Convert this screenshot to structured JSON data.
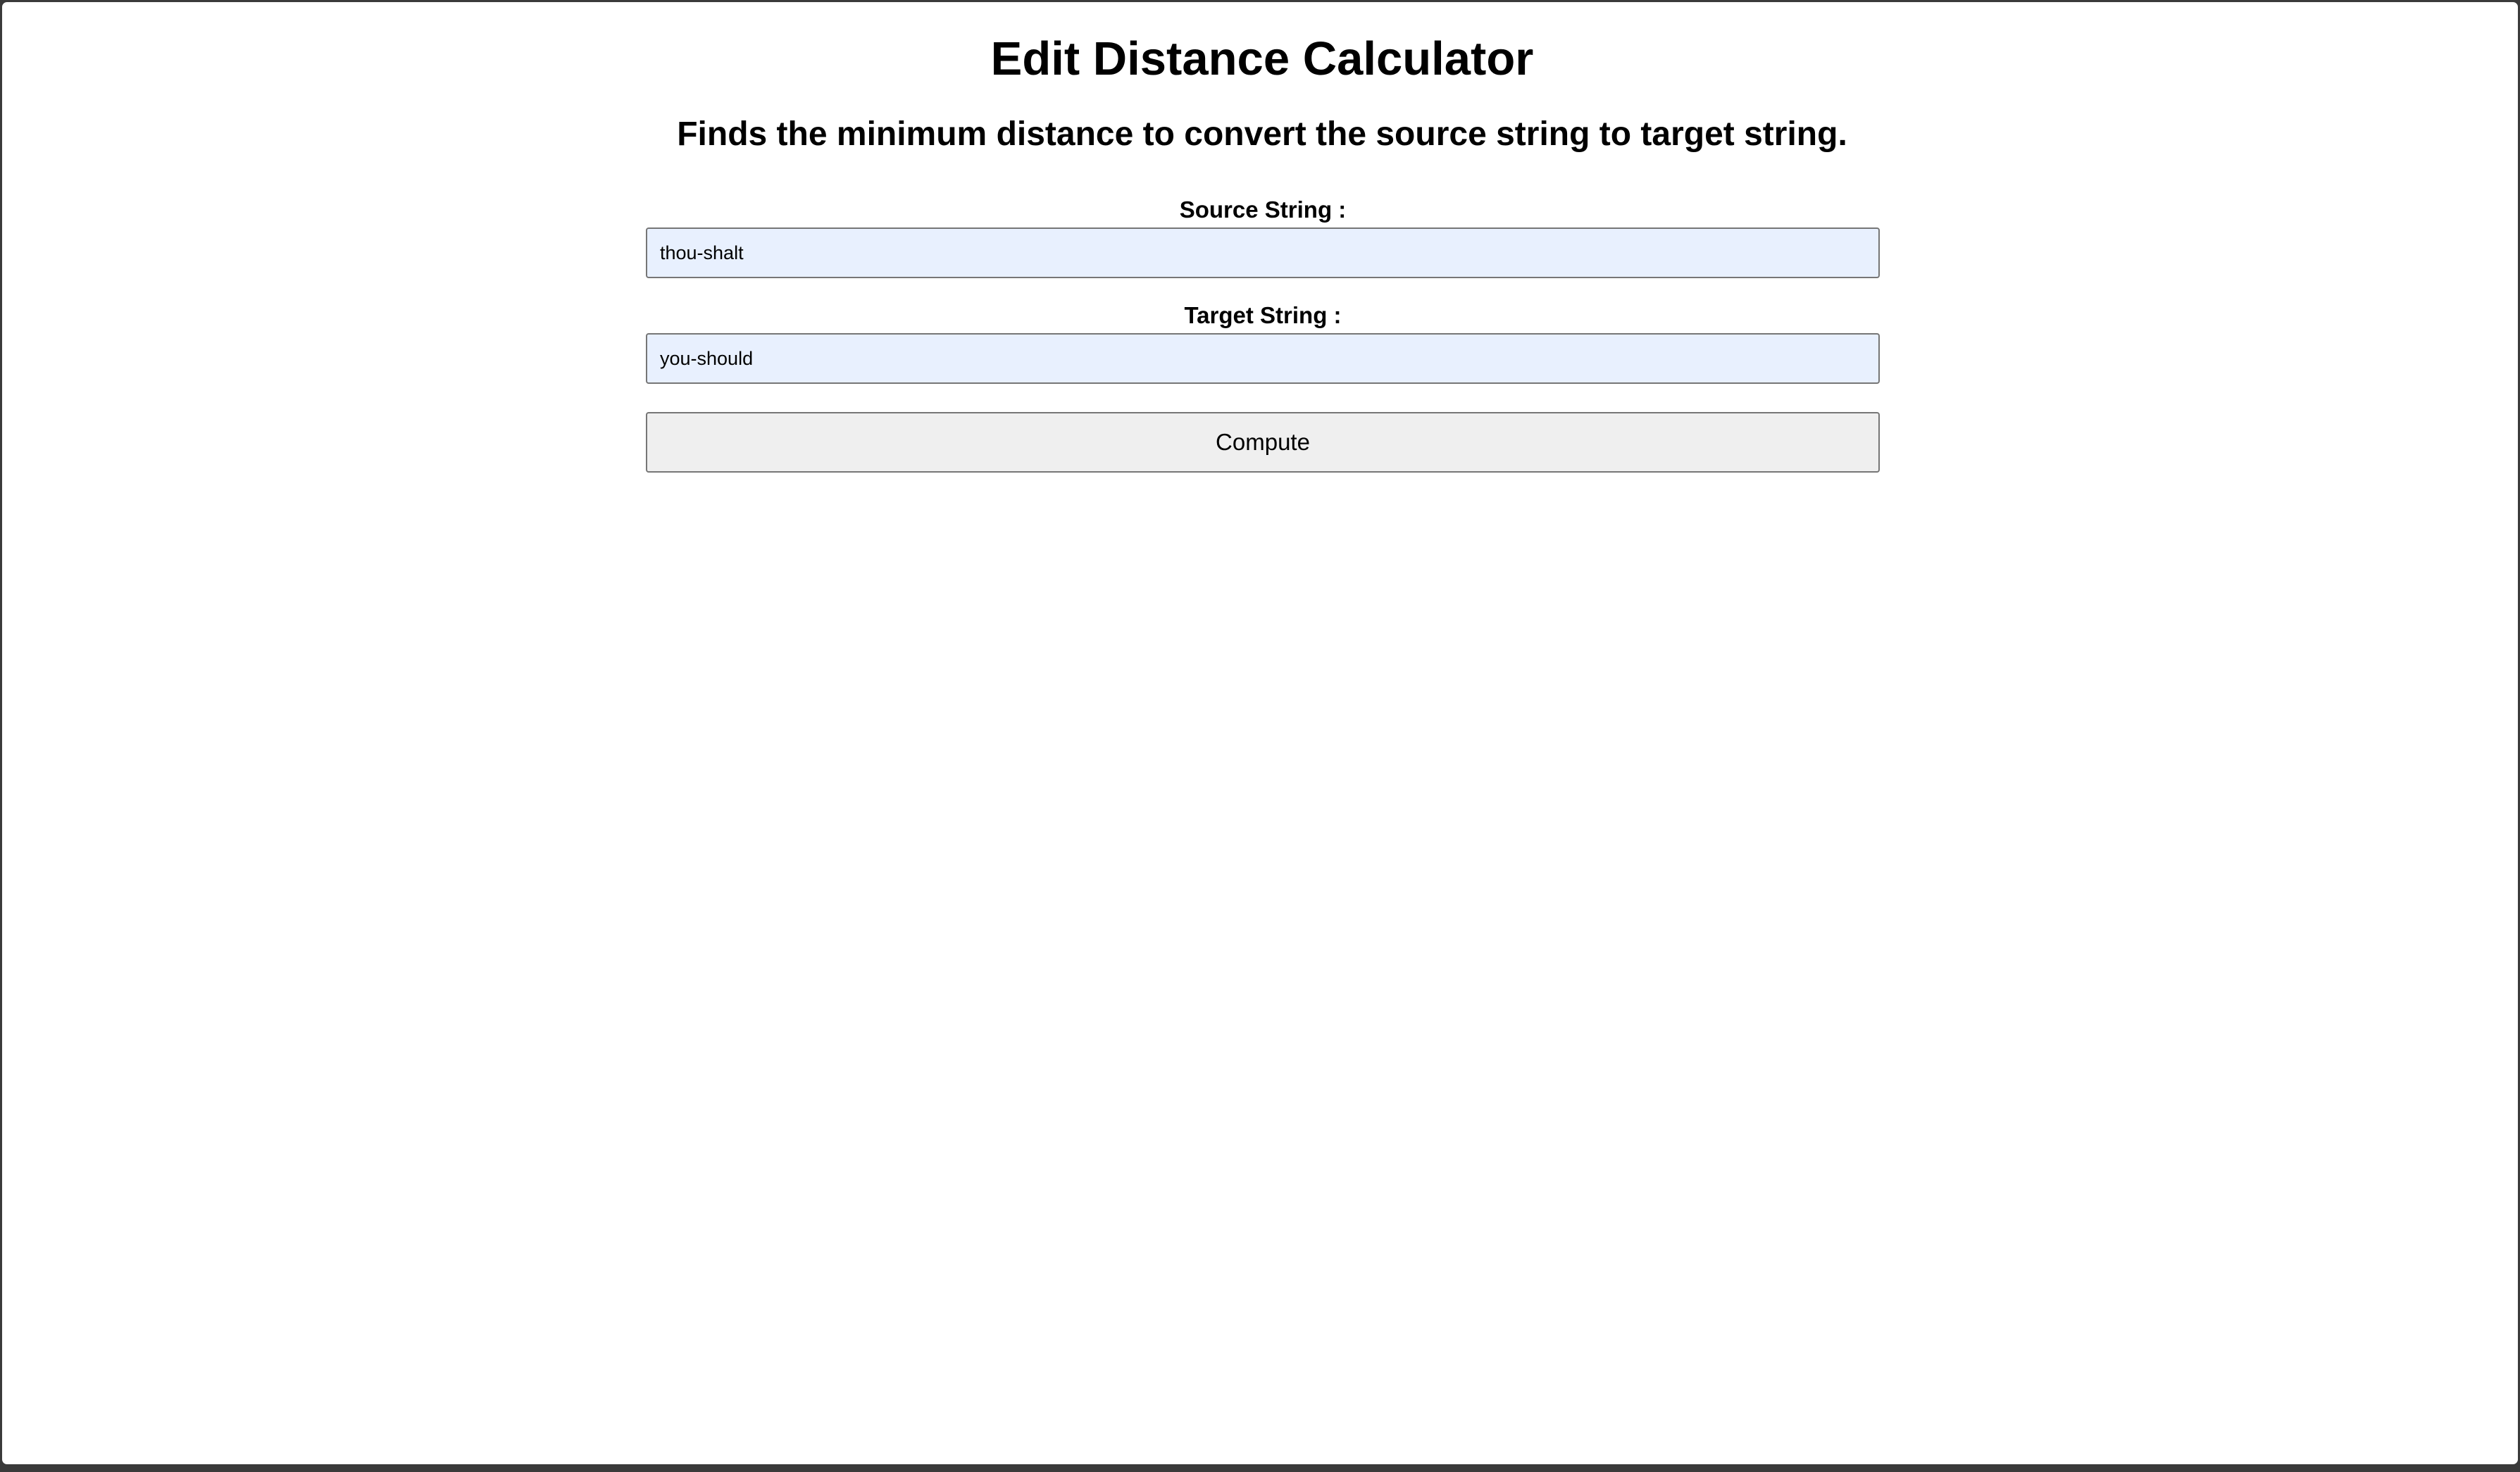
{
  "page": {
    "title": "Edit Distance Calculator",
    "subtitle": "Finds the minimum distance to convert the source string to target string."
  },
  "form": {
    "source_label": "Source String :",
    "source_value": "thou-shalt",
    "target_label": "Target String :",
    "target_value": "you-should",
    "compute_label": "Compute"
  },
  "colors": {
    "input_background": "#e8f0fe",
    "button_background": "#efefef",
    "border": "#767676"
  }
}
